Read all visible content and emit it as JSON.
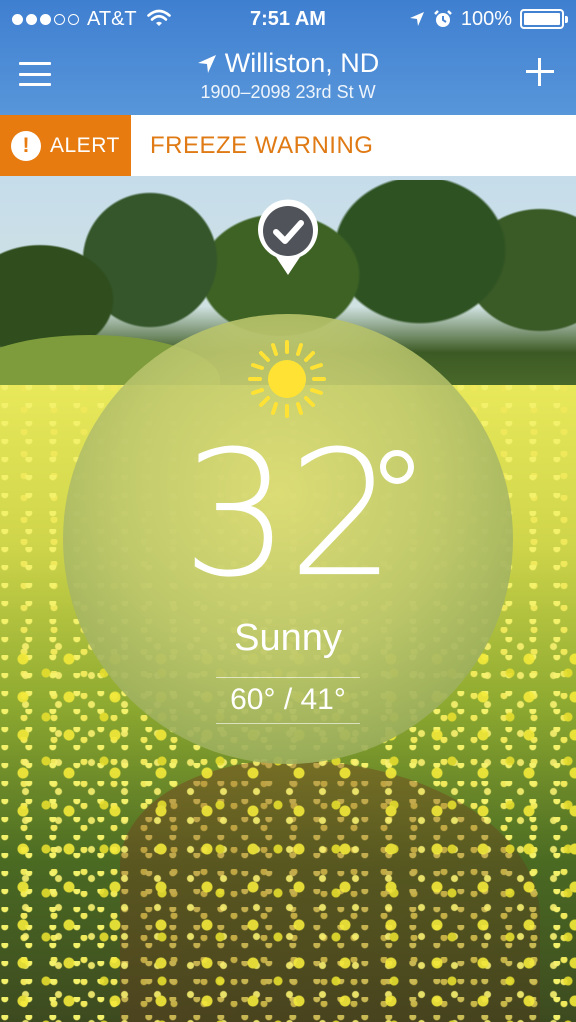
{
  "status_bar": {
    "carrier": "AT&T",
    "time": "7:51 AM",
    "battery": "100%",
    "battery_level": 1.0,
    "signal_dots_filled": 3,
    "signal_dots_total": 5
  },
  "header": {
    "city": "Williston, ND",
    "address": "1900–2098 23rd St W",
    "colors": {
      "bar_top": "#3f7fd0",
      "bar_bottom": "#5896da"
    }
  },
  "alert": {
    "badge_label": "ALERT",
    "message": "FREEZE WARNING",
    "colors": {
      "badge": "#e77b10",
      "text": "#df7a14"
    }
  },
  "weather": {
    "temperature": "32",
    "condition": "Sunny",
    "high_low": "60° / 41°",
    "icon": "sun-icon"
  },
  "icons": {
    "menu": "hamburger-menu-icon",
    "add": "plus-icon",
    "location": "location-arrow-icon",
    "marker": "check-marker-icon"
  }
}
